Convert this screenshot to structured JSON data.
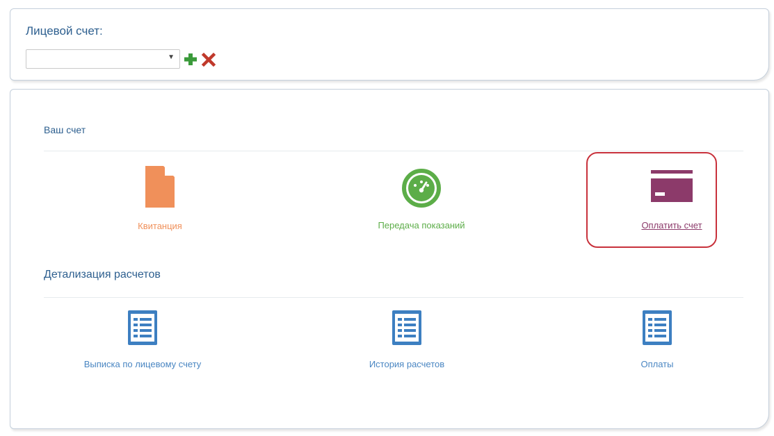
{
  "account": {
    "label": "Лицевой счет:",
    "selected_value": "",
    "add_icon": "plus-icon",
    "delete_icon": "x-icon"
  },
  "your_account": {
    "title": "Ваш счет",
    "items": [
      {
        "label": "Квитанция",
        "icon": "document-icon",
        "color": "#f0905a"
      },
      {
        "label": "Передача показаний",
        "icon": "speedometer-icon",
        "color": "#5cad48"
      },
      {
        "label": "Оплатить счет",
        "icon": "credit-card-icon",
        "color": "#8c3a6a",
        "highlighted": true
      }
    ]
  },
  "details": {
    "title": "Детализация расчетов",
    "items": [
      {
        "label": "Выписка по лицевому счету",
        "icon": "list-icon",
        "color": "#4a86c2"
      },
      {
        "label": "История расчетов",
        "icon": "list-icon",
        "color": "#4a86c2"
      },
      {
        "label": "Оплаты",
        "icon": "list-icon",
        "color": "#4a86c2"
      }
    ]
  },
  "colors": {
    "heading": "#2d5f8f",
    "add": "#3a9a3a",
    "delete": "#c0392b",
    "highlight_border": "#c8313b"
  }
}
